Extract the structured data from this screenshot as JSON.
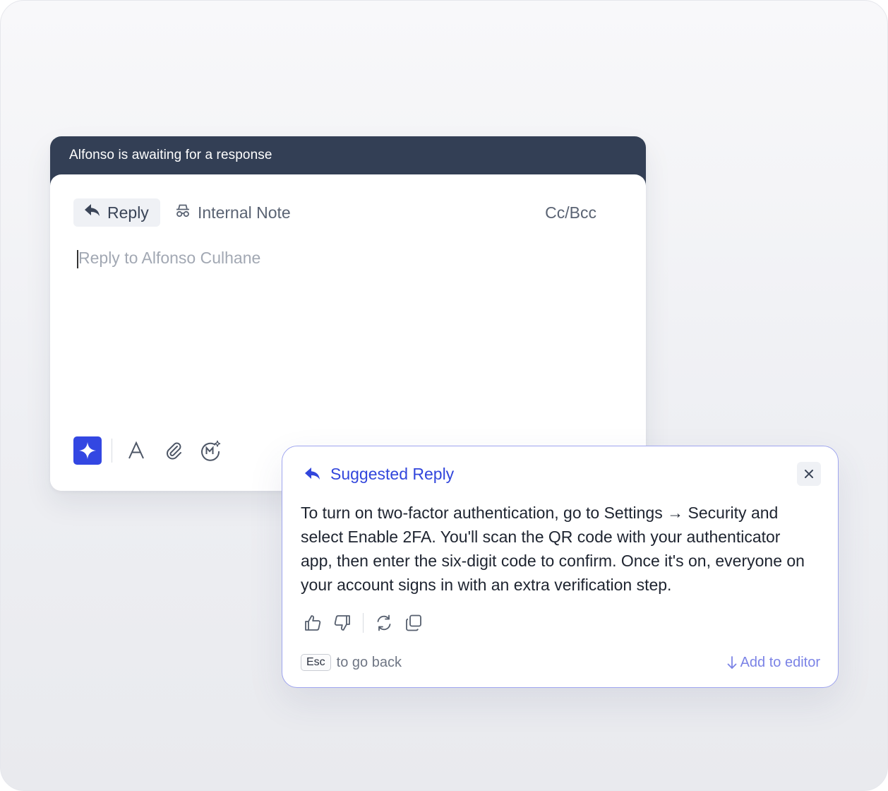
{
  "colors": {
    "banner_bg": "#333f55",
    "accent": "#3347e2",
    "suggest_border": "#9fa5ef",
    "add_link": "#7b83e6"
  },
  "banner": {
    "text": "Alfonso is awaiting for a response"
  },
  "tabs": [
    {
      "label": "Reply",
      "icon": "reply-arrow-icon",
      "active": true
    },
    {
      "label": "Internal Note",
      "icon": "incognito-icon",
      "active": false
    }
  ],
  "cc_bcc": "Cc/Bcc",
  "reply_input": {
    "placeholder": "Reply to Alfonso Culhane"
  },
  "toolbar": {
    "icons": [
      "sparkle-icon",
      "text-format-icon",
      "paperclip-icon",
      "macro-icon"
    ]
  },
  "suggestion": {
    "title": "Suggested Reply",
    "body": "To turn on two-factor authentication, go to Settings → Security and select Enable 2FA. You'll scan the QR code with your authenticator app, then enter the six-digit code to confirm. Once it's on, everyone on your account signs in with an extra verification step.",
    "actions": [
      "thumbs-up-icon",
      "thumbs-down-icon",
      "refresh-icon",
      "copy-icon"
    ],
    "esc_key": "Esc",
    "esc_hint": "to go back",
    "add_label": "Add to editor"
  }
}
